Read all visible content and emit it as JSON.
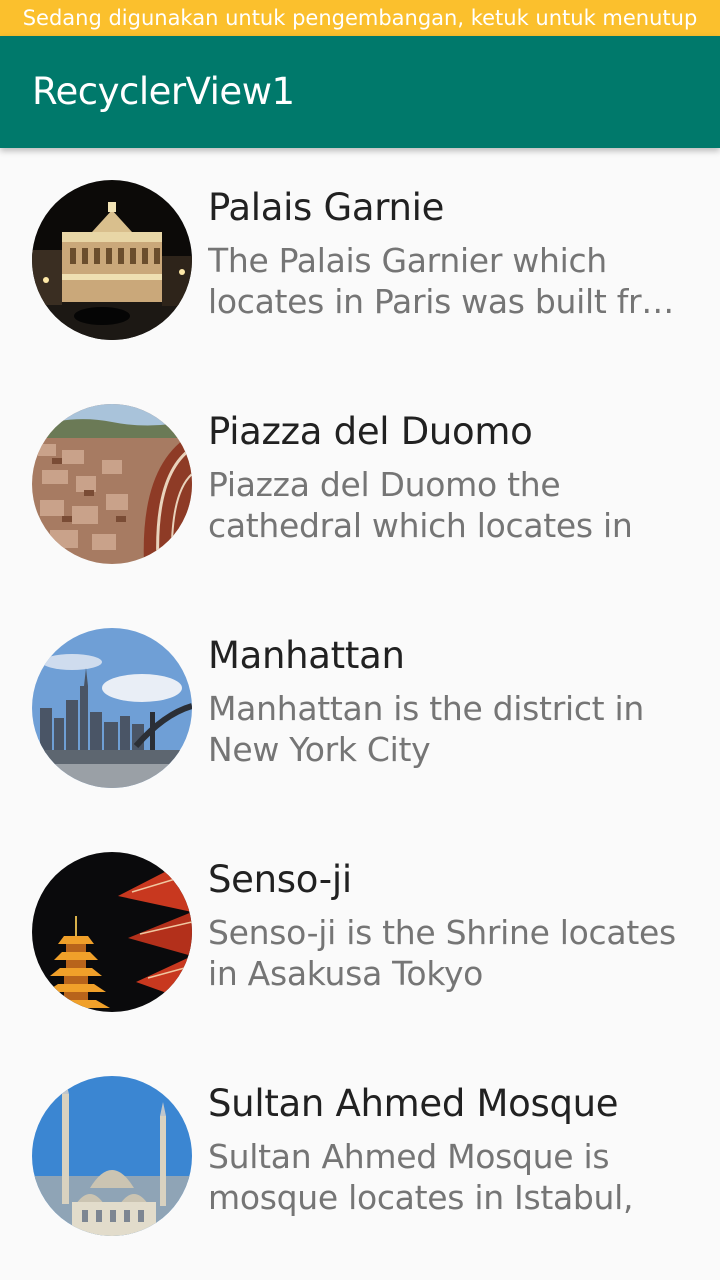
{
  "status_bar": {
    "notice": "Sedang digunakan untuk pengembangan, ketuk untuk menutup"
  },
  "app_bar": {
    "title": "RecyclerView1"
  },
  "items": [
    {
      "title": "Palais Garnie",
      "description": "The Palais Garnier which locates in Paris was built fr…",
      "image": "palais-garnier-image"
    },
    {
      "title": "Piazza del Duomo",
      "description": "Piazza del Duomo the cathedral which locates in F…",
      "image": "piazza-del-duomo-image"
    },
    {
      "title": "Manhattan",
      "description": "Manhattan is the district in New York City",
      "image": "manhattan-image"
    },
    {
      "title": "Senso-ji",
      "description": "Senso-ji is the Shrine locates in Asakusa Tokyo",
      "image": "senso-ji-image"
    },
    {
      "title": "Sultan Ahmed Mosque",
      "description": "Sultan Ahmed Mosque is mosque locates in Istabul, T…",
      "image": "sultan-ahmed-mosque-image"
    }
  ],
  "colors": {
    "status_bar": "#fbc02d",
    "app_bar": "#00796b",
    "background": "#fafafa",
    "title_text": "#212121",
    "description_text": "#757575"
  }
}
